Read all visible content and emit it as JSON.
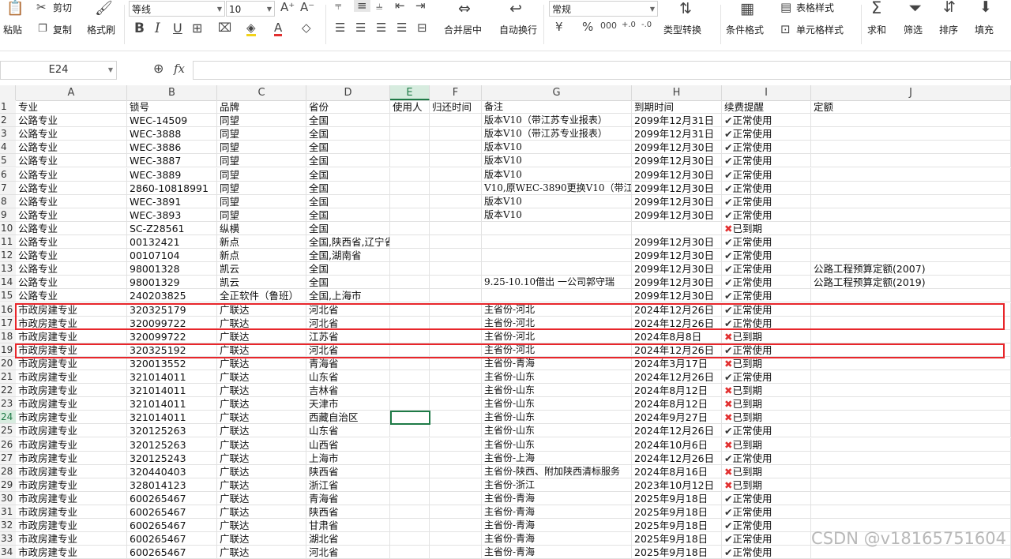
{
  "ribbon": {
    "cut": "剪切",
    "paste": "粘贴",
    "copy": "复制",
    "format_painter": "格式刷",
    "font_name": "等线",
    "font_size": "10",
    "merge": "合并居中",
    "wrap": "自动换行",
    "number_format": "常规",
    "type_convert": "类型转换",
    "cond_format": "条件格式",
    "table_style": "表格样式",
    "cell_style": "单元格样式",
    "sum": "求和",
    "filter": "筛选",
    "sort": "排序",
    "fill": "填充"
  },
  "formula_bar": {
    "name_box": "E24",
    "fx": "fx"
  },
  "columns": [
    {
      "id": "A"
    },
    {
      "id": "B"
    },
    {
      "id": "C"
    },
    {
      "id": "D"
    },
    {
      "id": "E"
    },
    {
      "id": "F"
    },
    {
      "id": "G"
    },
    {
      "id": "H"
    },
    {
      "id": "I"
    },
    {
      "id": "J"
    }
  ],
  "selected_cell": "E24",
  "status": {
    "ok": "正常使用",
    "expired": "已到期"
  },
  "rows": [
    {
      "n": "1",
      "A": "专业",
      "B": "锁号",
      "C": "品牌",
      "D": "省份",
      "E": "使用人",
      "F": "归还时间",
      "G": "备注",
      "H": "到期时间",
      "I": "续费提醒",
      "J": "定额"
    },
    {
      "n": "2",
      "A": "公路专业",
      "B": "WEC-14509",
      "C": "同望",
      "D": "全国",
      "G": "版本V10（带江苏专业报表）",
      "H": "2099年12月31日",
      "I": "ok"
    },
    {
      "n": "3",
      "A": "公路专业",
      "B": "WEC-3888",
      "C": "同望",
      "D": "全国",
      "G": "版本V10（带江苏专业报表）",
      "H": "2099年12月31日",
      "I": "ok"
    },
    {
      "n": "4",
      "A": "公路专业",
      "B": "WEC-3886",
      "C": "同望",
      "D": "全国",
      "G": "版本V10",
      "H": "2099年12月30日",
      "I": "ok"
    },
    {
      "n": "5",
      "A": "公路专业",
      "B": "WEC-3887",
      "C": "同望",
      "D": "全国",
      "G": "版本V10",
      "H": "2099年12月30日",
      "I": "ok"
    },
    {
      "n": "6",
      "A": "公路专业",
      "B": "WEC-3889",
      "C": "同望",
      "D": "全国",
      "G": "版本V10",
      "H": "2099年12月30日",
      "I": "ok"
    },
    {
      "n": "7",
      "A": "公路专业",
      "B": "2860-10818991",
      "C": "同望",
      "D": "全国",
      "G": "V10,原WEC-3890更换V10（带江",
      "H": "2099年12月30日",
      "I": "ok"
    },
    {
      "n": "8",
      "A": "公路专业",
      "B": "WEC-3891",
      "C": "同望",
      "D": "全国",
      "G": "版本V10",
      "H": "2099年12月30日",
      "I": "ok"
    },
    {
      "n": "9",
      "A": "公路专业",
      "B": "WEC-3893",
      "C": "同望",
      "D": "全国",
      "G": "版本V10",
      "H": "2099年12月30日",
      "I": "ok"
    },
    {
      "n": "10",
      "A": "公路专业",
      "B": "SC-Z28561",
      "C": "纵横",
      "D": "全国",
      "I": "expired"
    },
    {
      "n": "11",
      "A": "公路专业",
      "B": "00132421",
      "C": "新点",
      "D": "全国,陕西省,辽宁省",
      "H": "2099年12月30日",
      "I": "ok"
    },
    {
      "n": "12",
      "A": "公路专业",
      "B": "00107104",
      "C": "新点",
      "D": "全国,湖南省",
      "H": "2099年12月30日",
      "I": "ok"
    },
    {
      "n": "13",
      "A": "公路专业",
      "B": "98001328",
      "C": "凯云",
      "D": "全国",
      "H": "2099年12月30日",
      "I": "ok",
      "J": "公路工程预算定额(2007)"
    },
    {
      "n": "14",
      "A": "公路专业",
      "B": "98001329",
      "C": "凯云",
      "D": "全国",
      "G": "9.25-10.10借出 一公司郭守瑞",
      "H": "2099年12月30日",
      "I": "ok",
      "J": "公路工程预算定额(2019)"
    },
    {
      "n": "15",
      "A": "公路专业",
      "B": "240203825",
      "C": "全正软件（鲁班）",
      "D": "全国,上海市",
      "H": "2099年12月30日",
      "I": "ok"
    },
    {
      "n": "16",
      "A": "市政房建专业",
      "B": "320325179",
      "C": "广联达",
      "D": "河北省",
      "G": "主省份-河北",
      "H": "2024年12月26日",
      "I": "ok"
    },
    {
      "n": "17",
      "A": "市政房建专业",
      "B": "320099722",
      "C": "广联达",
      "D": "河北省",
      "G": "主省份-河北",
      "H": "2024年12月26日",
      "I": "ok"
    },
    {
      "n": "18",
      "A": "市政房建专业",
      "B": "320099722",
      "C": "广联达",
      "D": "江苏省",
      "G": "主省份-河北",
      "H": "2024年8月8日",
      "I": "expired"
    },
    {
      "n": "19",
      "A": "市政房建专业",
      "B": "320325192",
      "C": "广联达",
      "D": "河北省",
      "G": "主省份-河北",
      "H": "2024年12月26日",
      "I": "ok"
    },
    {
      "n": "20",
      "A": "市政房建专业",
      "B": "320013552",
      "C": "广联达",
      "D": "青海省",
      "G": "主省份-青海",
      "H": "2024年3月17日",
      "I": "expired"
    },
    {
      "n": "21",
      "A": "市政房建专业",
      "B": "321014011",
      "C": "广联达",
      "D": "山东省",
      "G": "主省份-山东",
      "H": "2024年12月26日",
      "I": "ok"
    },
    {
      "n": "22",
      "A": "市政房建专业",
      "B": "321014011",
      "C": "广联达",
      "D": "吉林省",
      "G": "主省份-山东",
      "H": "2024年8月12日",
      "I": "expired"
    },
    {
      "n": "23",
      "A": "市政房建专业",
      "B": "321014011",
      "C": "广联达",
      "D": "天津市",
      "G": "主省份-山东",
      "H": "2024年8月12日",
      "I": "expired"
    },
    {
      "n": "24",
      "A": "市政房建专业",
      "B": "321014011",
      "C": "广联达",
      "D": "西藏自治区",
      "G": "主省份-山东",
      "H": "2024年9月27日",
      "I": "expired"
    },
    {
      "n": "25",
      "A": "市政房建专业",
      "B": "320125263",
      "C": "广联达",
      "D": "山东省",
      "G": "主省份-山东",
      "H": "2024年12月26日",
      "I": "ok"
    },
    {
      "n": "26",
      "A": "市政房建专业",
      "B": "320125263",
      "C": "广联达",
      "D": "山西省",
      "G": "主省份-山东",
      "H": "2024年10月6日",
      "I": "expired"
    },
    {
      "n": "27",
      "A": "市政房建专业",
      "B": "320125243",
      "C": "广联达",
      "D": "上海市",
      "G": "主省份-上海",
      "H": "2024年12月26日",
      "I": "ok"
    },
    {
      "n": "28",
      "A": "市政房建专业",
      "B": "320440403",
      "C": "广联达",
      "D": "陕西省",
      "G": "主省份-陕西、附加陕西清标服务",
      "H": "2024年8月16日",
      "I": "expired"
    },
    {
      "n": "29",
      "A": "市政房建专业",
      "B": "328014123",
      "C": "广联达",
      "D": "浙江省",
      "G": "主省份-浙江",
      "H": "2023年10月12日",
      "I": "expired"
    },
    {
      "n": "30",
      "A": "市政房建专业",
      "B": "600265467",
      "C": "广联达",
      "D": "青海省",
      "G": "主省份-青海",
      "H": "2025年9月18日",
      "I": "ok"
    },
    {
      "n": "31",
      "A": "市政房建专业",
      "B": "600265467",
      "C": "广联达",
      "D": "陕西省",
      "G": "主省份-青海",
      "H": "2025年9月18日",
      "I": "ok"
    },
    {
      "n": "32",
      "A": "市政房建专业",
      "B": "600265467",
      "C": "广联达",
      "D": "甘肃省",
      "G": "主省份-青海",
      "H": "2025年9月18日",
      "I": "ok"
    },
    {
      "n": "33",
      "A": "市政房建专业",
      "B": "600265467",
      "C": "广联达",
      "D": "湖北省",
      "G": "主省份-青海",
      "H": "2025年9月18日",
      "I": "ok"
    },
    {
      "n": "34",
      "A": "市政房建专业",
      "B": "600265467",
      "C": "广联达",
      "D": "河北省",
      "G": "主省份-青海",
      "H": "2025年9月18日",
      "I": "ok"
    }
  ],
  "highlighted_rows": [
    "16",
    "17",
    "19"
  ],
  "watermark": "CSDN @v18165751604",
  "colors": {
    "accent": "#1e7a46",
    "highlight": "#e8262b",
    "expired": "#e23030"
  }
}
